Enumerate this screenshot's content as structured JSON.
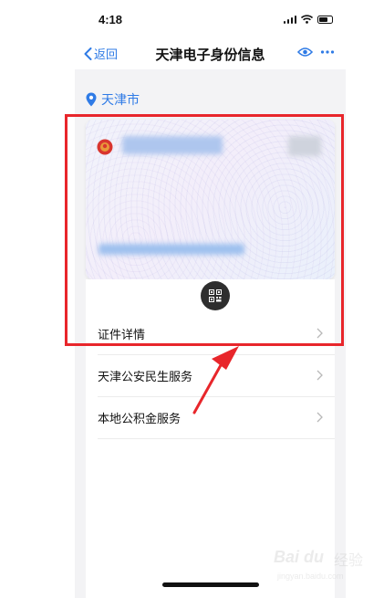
{
  "status_bar": {
    "time": "4:18"
  },
  "nav": {
    "back_label": "返回",
    "title": "天津电子身份信息"
  },
  "location": {
    "city": "天津市"
  },
  "menu": [
    {
      "label": "证件详情"
    },
    {
      "label": "天津公安民生服务"
    },
    {
      "label": "本地公积金服务"
    }
  ],
  "icons": {
    "back": "chevron-left-icon",
    "eye": "eye-icon",
    "more": "more-icon",
    "location": "location-pin-icon",
    "qr": "qr-code-icon",
    "row_chevron": "chevron-right-icon"
  },
  "watermark": {
    "brand": "Bai du",
    "label": "经验",
    "url": "jingyan.baidu.com"
  },
  "colors": {
    "accent": "#2f7be6",
    "annotation_red": "#e8262b",
    "background": "#f3f3f5"
  }
}
